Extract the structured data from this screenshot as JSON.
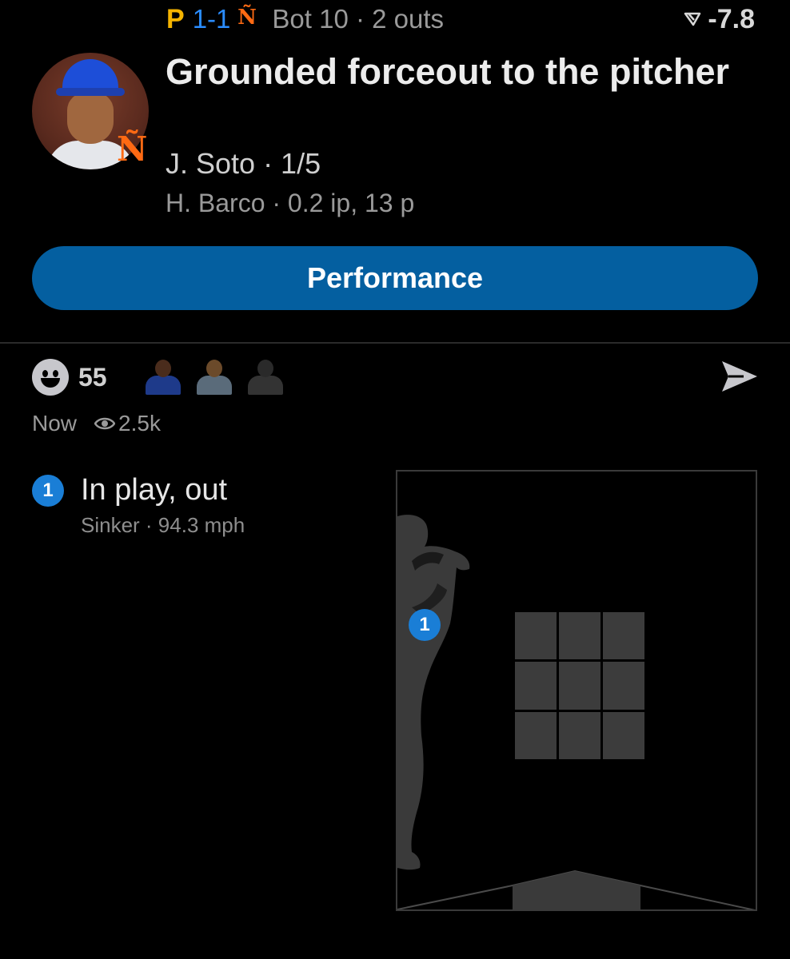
{
  "header": {
    "away_team": "P",
    "score": "1-1",
    "home_team_logo": "NY",
    "inning_status": "Bot 10 · 2 outs",
    "win_prob_icon": "wpa-arrow-icon",
    "win_prob_value": "-7.8"
  },
  "play": {
    "headline": "Grounded forceout to the pitcher",
    "batter": "J. Soto · 1/5",
    "pitcher": "H. Barco · 0.2 ip, 13 p"
  },
  "button": {
    "performance_label": "Performance"
  },
  "reactions": {
    "count": "55",
    "timestamp": "Now",
    "views": "2.5k"
  },
  "pitches": [
    {
      "number": "1",
      "result": "In play, out",
      "detail": "Sinker · 94.3 mph"
    }
  ],
  "colors": {
    "accent_blue": "#1a7ed6",
    "button_blue": "#045fa0",
    "pirates_gold": "#f5b400",
    "mets_orange": "#ff6a13"
  }
}
